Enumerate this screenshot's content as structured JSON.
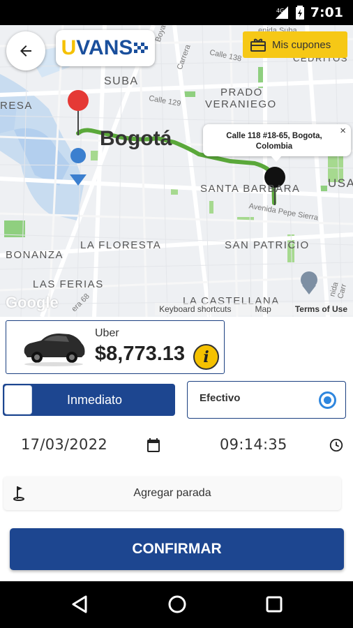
{
  "status_bar": {
    "time": "7:01",
    "network": "4G"
  },
  "map": {
    "labels": {
      "suba": "SUBA",
      "bogota": "Bogotá",
      "prado": "PRADO",
      "veraniego": "VERANIEGO",
      "santa_barbara": "SANTA BARBARA",
      "la_floresta": "LA FLORESTA",
      "bonanza": "BONANZA",
      "las_ferias": "LAS FERIAS",
      "san_patricio": "SAN PATRICIO",
      "la_castellana": "LA CASTELLANA",
      "cedritos": "CEDRITOS",
      "resa": "RESA",
      "usa": "USA"
    },
    "streets": {
      "calle_138": "Calle 138",
      "calle_129": "Calle 129",
      "carrera": "Carrera",
      "avenida_pepe_sierra": "Avenida Pepe Sierra",
      "boyaca": "Boya",
      "avenida": "enida Suba",
      "cra_68": "era 68",
      "avenida_right": "nida Carr"
    },
    "info_window": {
      "text": "Calle 118 #18-65, Bogota, Colombia",
      "close": "×"
    },
    "google": "Google",
    "footer": {
      "shortcuts": "Keyboard shortcuts",
      "map": "Map",
      "terms": "Terms of Use"
    }
  },
  "header": {
    "logo_u": "U",
    "logo_vans": "VANS",
    "coupons_label": "Mis cupones"
  },
  "vehicle": {
    "name": "Uber",
    "price": "$8,773.13",
    "info": "i"
  },
  "mode": {
    "label": "Inmediato"
  },
  "payment": {
    "label": "Efectivo"
  },
  "schedule": {
    "date": "17/03/2022",
    "time": "09:14:35"
  },
  "stop": {
    "label": "Agregar parada"
  },
  "confirm": {
    "label": "CONFIRMAR"
  },
  "colors": {
    "primary": "#1d4690",
    "accent": "#f5c100",
    "route": "#5aa83a",
    "radio": "#2e86de"
  }
}
